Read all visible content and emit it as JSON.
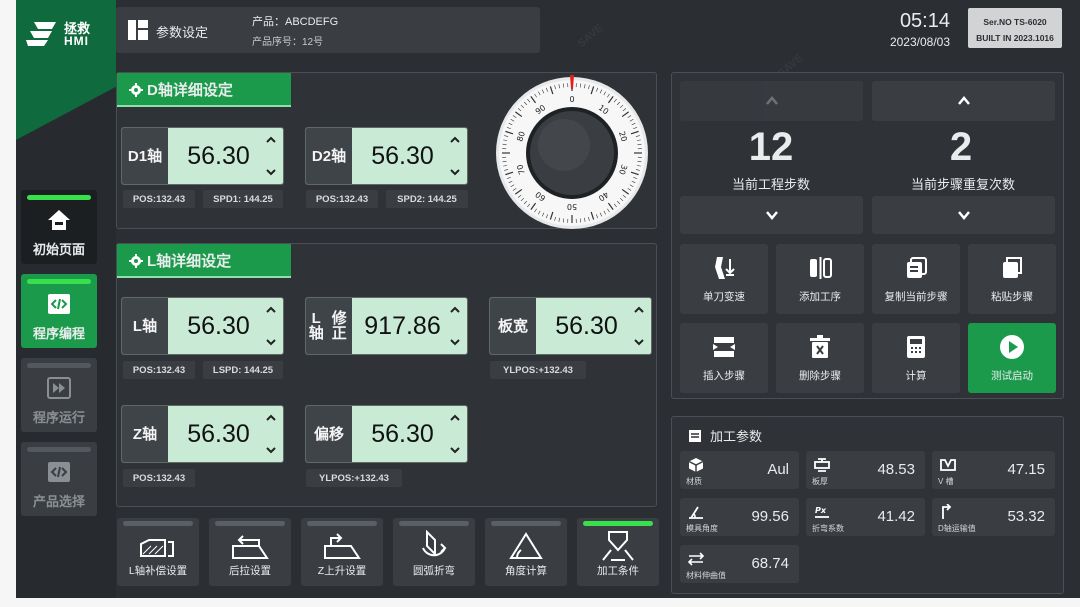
{
  "brand": {
    "logo_cn": "拯救",
    "logo_en": "HMI"
  },
  "header": {
    "title": "参数设定",
    "product": "产品：ABCDEFG",
    "product_seq": "产品序号：12号"
  },
  "clock": {
    "time": "05:14",
    "date": "2023/08/03"
  },
  "serial": {
    "line1": "Ser.NO TS-6020",
    "line2": "BUILT IN 2023.1016"
  },
  "nav": [
    {
      "label": "初始页面",
      "icon": "home-icon"
    },
    {
      "label": "程序编程",
      "icon": "code-icon"
    },
    {
      "label": "程序运行",
      "icon": "fast-forward-icon"
    },
    {
      "label": "产品选择",
      "icon": "code-icon"
    }
  ],
  "d_section": {
    "title": "D轴详细设定",
    "d1": {
      "name": "D1轴",
      "value": "56.30"
    },
    "d2": {
      "name": "D2轴",
      "value": "56.30"
    },
    "pos1": "POS:132.43",
    "spd1": "SPD1: 144.25",
    "pos2": "POS:132.43",
    "spd2": "SPD2: 144.25"
  },
  "dial": {
    "labels": [
      "0",
      "10",
      "20",
      "30",
      "40",
      "50",
      "60",
      "70",
      "80",
      "90"
    ]
  },
  "l_section": {
    "title": "L轴详细设定",
    "l": {
      "name": "L轴",
      "value": "56.30"
    },
    "lfix": {
      "name1": "L轴",
      "name2": "修正",
      "value": "917.86"
    },
    "plate": {
      "name": "板宽",
      "value": "56.30"
    },
    "pos_l": "POS:132.43",
    "lspd": "LSPD: 144.25",
    "ylpos1": "YLPOS:+132.43",
    "z": {
      "name": "Z轴",
      "value": "56.30"
    },
    "offset": {
      "name": "偏移",
      "value": "56.30"
    },
    "pos_z": "POS:132.43",
    "ylpos2": "YLPOS:+132.43"
  },
  "steps": {
    "current_step": "12",
    "current_step_label": "当前工程步数",
    "repeat": "2",
    "repeat_label": "当前步骤重复次数"
  },
  "actions": [
    {
      "label": "单刀变速",
      "icon": "tool-speed-icon"
    },
    {
      "label": "添加工序",
      "icon": "add-process-icon"
    },
    {
      "label": "复制当前步骤",
      "icon": "copy-step-icon"
    },
    {
      "label": "粘贴步骤",
      "icon": "paste-icon"
    },
    {
      "label": "插入步骤",
      "icon": "insert-step-icon"
    },
    {
      "label": "删除步骤",
      "icon": "delete-icon"
    },
    {
      "label": "计算",
      "icon": "calculator-icon"
    },
    {
      "label": "测试启动",
      "icon": "play-icon"
    }
  ],
  "params": {
    "title": "加工参数",
    "items": [
      {
        "label": "材质",
        "value": "Aul",
        "icon": "cube-icon"
      },
      {
        "label": "板厚",
        "value": "48.53",
        "icon": "thickness-icon"
      },
      {
        "label": "V 槽",
        "value": "47.15",
        "icon": "v-groove-icon"
      },
      {
        "label": "模具角度",
        "value": "99.56",
        "icon": "angle-icon"
      },
      {
        "label": "折弯系数",
        "value": "41.42",
        "icon": "bend-factor-icon"
      },
      {
        "label": "D轴运输值",
        "value": "53.32",
        "icon": "d-axis-icon"
      },
      {
        "label": "材料伸曲值",
        "value": "68.74",
        "icon": "stretch-icon"
      }
    ]
  },
  "tools": [
    {
      "label": "L轴补偿设置",
      "icon": "l-compensation-icon"
    },
    {
      "label": "后拉设置",
      "icon": "back-pull-icon"
    },
    {
      "label": "Z上升设置",
      "icon": "z-rise-icon"
    },
    {
      "label": "圆弧折弯",
      "icon": "arc-bend-icon"
    },
    {
      "label": "角度计算",
      "icon": "angle-calc-icon"
    },
    {
      "label": "加工条件",
      "icon": "process-condition-icon"
    }
  ],
  "colors": {
    "accent": "#1c9a4b",
    "active_bar": "#39e04e",
    "value_bg": "#c9ebd6",
    "panel": "#2b2f33"
  }
}
